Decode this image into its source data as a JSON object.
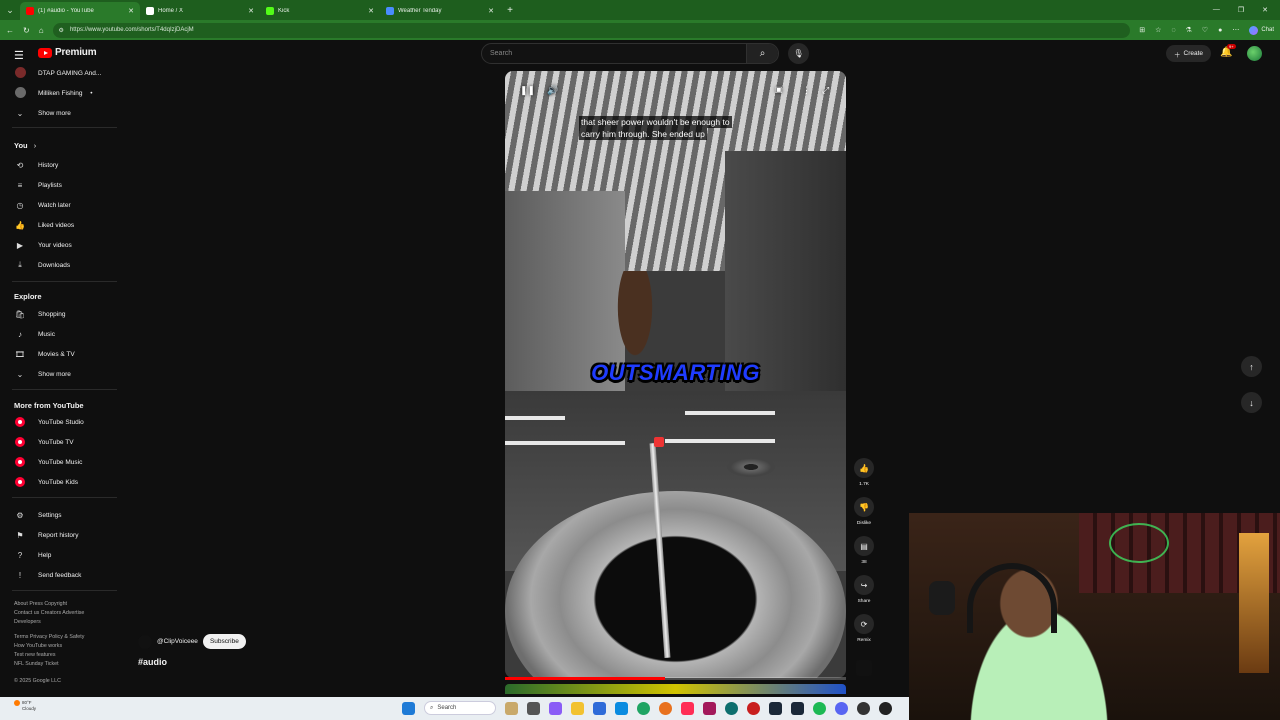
{
  "browser": {
    "tabs": [
      {
        "label": "(1) #audio - YouTube",
        "favicon_color": "#ff0000",
        "active": true
      },
      {
        "label": "Home / X",
        "favicon_color": "#ffffff",
        "active": false
      },
      {
        "label": "Kick",
        "favicon_color": "#53fc18",
        "active": false
      },
      {
        "label": "Weather Tenday",
        "favicon_color": "#4a8cff",
        "active": false
      }
    ],
    "url": "https://www.youtube.com/shorts/T4dqIzjDAcjM",
    "chat_label": "Chat"
  },
  "header": {
    "logo_text": "Premium",
    "search_placeholder": "Search",
    "create_label": "Create",
    "notification_count": "9+"
  },
  "sidebar": {
    "subscriptions": [
      {
        "label": "DTAP GAMING And...",
        "avatar_color": "#7a2a2a"
      },
      {
        "label": "Milliken Fishing",
        "avatar_color": "#6a6a6a",
        "dot": "•"
      }
    ],
    "show_more_1": "Show more",
    "you_heading": "You",
    "you_items": [
      {
        "label": "History",
        "icon": "history-icon",
        "glyph": "⟲"
      },
      {
        "label": "Playlists",
        "icon": "playlists-icon",
        "glyph": "≡"
      },
      {
        "label": "Watch later",
        "icon": "clock-icon",
        "glyph": "◷"
      },
      {
        "label": "Liked videos",
        "icon": "thumb-up-icon",
        "glyph": "👍"
      },
      {
        "label": "Your videos",
        "icon": "video-icon",
        "glyph": "▶"
      },
      {
        "label": "Downloads",
        "icon": "download-icon",
        "glyph": "⤓"
      }
    ],
    "explore_heading": "Explore",
    "explore_items": [
      {
        "label": "Shopping",
        "icon": "shopping-bag-icon",
        "glyph": "🛍"
      },
      {
        "label": "Music",
        "icon": "music-note-icon",
        "glyph": "♪"
      },
      {
        "label": "Movies & TV",
        "icon": "film-icon",
        "glyph": "🎞"
      }
    ],
    "show_more_2": "Show more",
    "more_heading": "More from YouTube",
    "more_items": [
      {
        "label": "YouTube Studio"
      },
      {
        "label": "YouTube TV"
      },
      {
        "label": "YouTube Music"
      },
      {
        "label": "YouTube Kids"
      }
    ],
    "settings_items": [
      {
        "label": "Settings",
        "icon": "gear-icon",
        "glyph": "⚙"
      },
      {
        "label": "Report history",
        "icon": "flag-icon",
        "glyph": "⚑"
      },
      {
        "label": "Help",
        "icon": "help-icon",
        "glyph": "?"
      },
      {
        "label": "Send feedback",
        "icon": "feedback-icon",
        "glyph": "!"
      }
    ],
    "footer_1": "About  Press  Copyright",
    "footer_2": "Contact us  Creators  Advertise",
    "footer_3": "Developers",
    "footer_4": "Terms  Privacy  Policy & Safety",
    "footer_5": "How YouTube works",
    "footer_6": "Test new features",
    "footer_7": "NFL Sunday Ticket",
    "copyright": "© 2025 Google LLC"
  },
  "short": {
    "caption_line1": "that sheer power wouldn't be enough to",
    "caption_line2": "carry him through. She ended up",
    "overlay_word": "OUTSMARTING",
    "channel_name": "@ClipVoiceee",
    "subscribe_label": "Subscribe",
    "hashtag": "#audio",
    "progress": 0.47,
    "like_count": "1.7K",
    "dislike_label": "Dislike",
    "comment_count": "38",
    "share_label": "Share",
    "remix_label": "Remix"
  },
  "taskbar": {
    "temperature": "80°F",
    "condition": "Cloudy",
    "search_label": "Search"
  },
  "colors": {
    "accent": "#ff0000",
    "background": "#0f0f0f",
    "browser_frame": "#2a7a2a"
  }
}
